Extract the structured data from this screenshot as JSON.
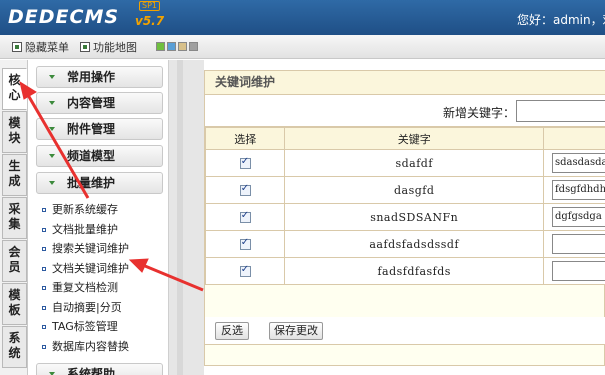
{
  "header": {
    "logo": "DEDECMS",
    "edition": "SP1",
    "version": "v5.7",
    "greeting": "您好：admin，欢"
  },
  "toolbar": {
    "hide_menu": "隐藏菜单",
    "site_map": "功能地图",
    "skin_colors": [
      "#6fbf3f",
      "#5a9fd6",
      "#d7c08a",
      "#a0a0a0"
    ]
  },
  "vertical_tabs": [
    "核心",
    "模块",
    "生成",
    "采集",
    "会员",
    "模板",
    "系统"
  ],
  "menu": {
    "groups": [
      "常用操作",
      "内容管理",
      "附件管理",
      "频道模型",
      "批量维护"
    ],
    "batch_items": [
      "更新系统缓存",
      "文档批量维护",
      "搜索关键词维护",
      "文档关键词维护",
      "重复文档检测",
      "自动摘要|分页",
      "TAG标签管理",
      "数据库内容替换"
    ],
    "footer_group": "系统帮助"
  },
  "panel": {
    "title": "关键词维护",
    "new_keyword_label": "新增关键字：",
    "columns": {
      "select": "选择",
      "keyword": "关键字"
    },
    "rows": [
      {
        "keyword": "sdafdf",
        "value": "sdasdasdas",
        "checked": true
      },
      {
        "keyword": "dasgfd",
        "value": "fdsgfdhdhh",
        "checked": true
      },
      {
        "keyword": "snadSDSANFn",
        "value": "dgfgsdga",
        "checked": true
      },
      {
        "keyword": "aafdsfadsdssdf",
        "value": "",
        "checked": true
      },
      {
        "keyword": "fadsfdfasfds",
        "value": "",
        "checked": true
      }
    ],
    "invert_button": "反选",
    "save_button": "保存更改"
  },
  "colors": {
    "header_blue": "#1f4f86",
    "panel_title_bg": "#fbf6dc",
    "arrow_red": "#e8312f"
  }
}
